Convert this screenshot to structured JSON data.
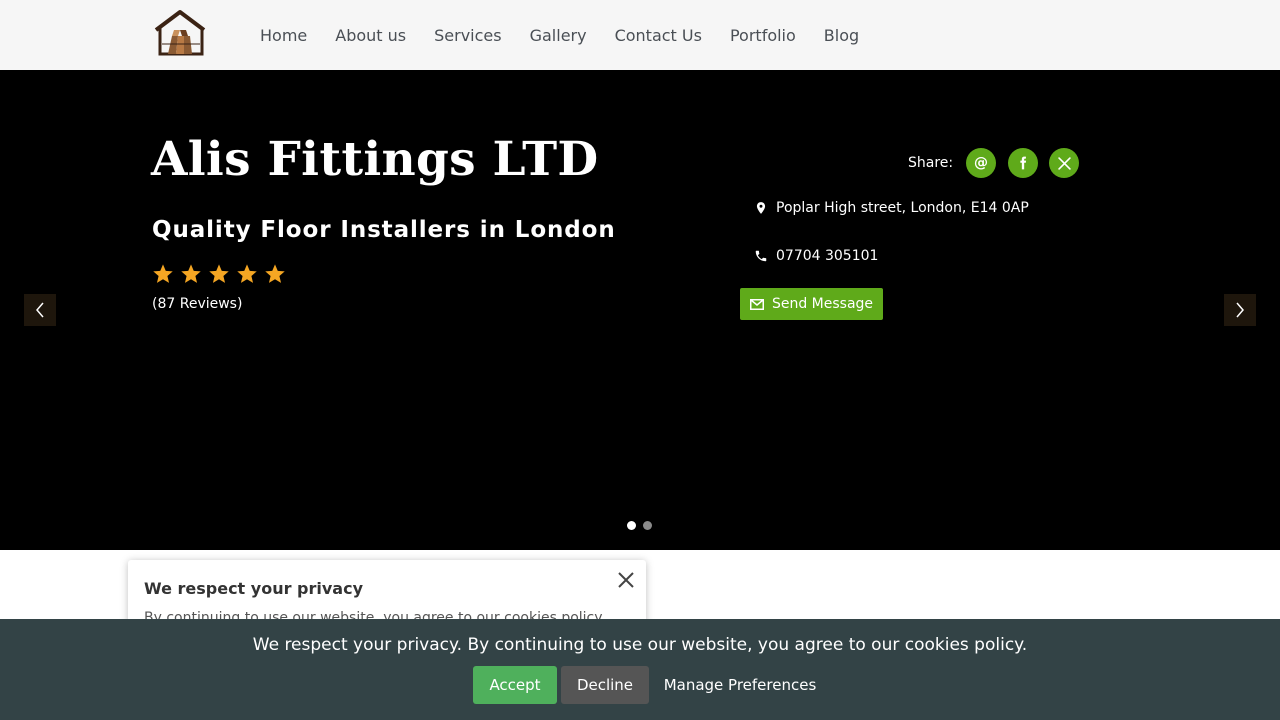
{
  "header": {
    "logo_name": "house-floor-logo",
    "nav": [
      {
        "label": "Home"
      },
      {
        "label": "About us"
      },
      {
        "label": "Services"
      },
      {
        "label": "Gallery"
      },
      {
        "label": "Contact Us"
      },
      {
        "label": "Portfolio"
      },
      {
        "label": "Blog"
      }
    ]
  },
  "hero": {
    "title": "Alis Fittings LTD",
    "subtitle": "Quality Floor Installers in London",
    "rating": 5,
    "reviews": "(87 Reviews)",
    "share_label": "Share:",
    "share_icons": [
      "email-icon",
      "facebook-icon",
      "x-icon"
    ],
    "address": "Poplar High street, London, E14 0AP",
    "phone": "07704 305101",
    "send_message": "Send Message",
    "slides_total": 2,
    "active_slide": 1
  },
  "privacy_popup": {
    "title": "We respect your privacy",
    "text": "By continuing to use our website, you agree to our cookies policy."
  },
  "cookie_bar": {
    "text": "We respect your privacy. By continuing to use our website, you agree to our cookies policy.",
    "accept": "Accept",
    "decline": "Decline",
    "manage": "Manage Preferences"
  },
  "colors": {
    "accent_green": "#5faa1a",
    "star_gold": "#f5a623",
    "cookie_bar_bg": "#334346",
    "accept_bg": "#4fb05c",
    "decline_bg": "#555555"
  }
}
